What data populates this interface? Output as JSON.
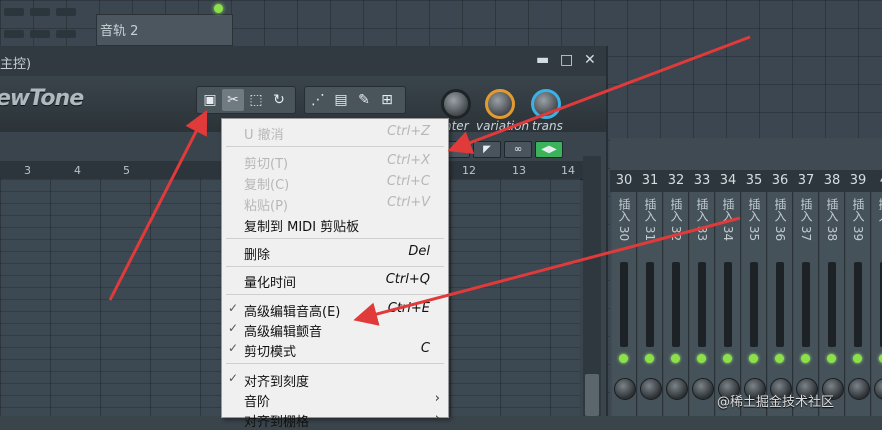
{
  "playlist": {
    "track_label": "音轨 2"
  },
  "window": {
    "title": "主控)",
    "minimize": "▬",
    "maximize": "□",
    "close": "✕",
    "logo": "ewTone",
    "knobs": [
      "nter",
      "variation",
      "trans"
    ],
    "ruler": [
      "3",
      "4",
      "5",
      "12",
      "13",
      "14"
    ]
  },
  "mixer": {
    "numbers": [
      "30",
      "31",
      "32",
      "33",
      "34",
      "35",
      "36",
      "37",
      "38",
      "39",
      "4"
    ],
    "labels": [
      "插入 30",
      "插入 31",
      "插入 32",
      "插入 33",
      "插入 34",
      "插入 35",
      "插入 36",
      "插入 37",
      "插入 38",
      "插入 39",
      "插入"
    ]
  },
  "menu": {
    "items": [
      {
        "label": "U 撤消",
        "shortcut": "Ctrl+Z"
      },
      {
        "label": "剪切(T)",
        "shortcut": "Ctrl+X"
      },
      {
        "label": "复制(C)",
        "shortcut": "Ctrl+C"
      },
      {
        "label": "粘贴(P)",
        "shortcut": "Ctrl+V"
      },
      {
        "label": "复制到 MIDI 剪贴板",
        "shortcut": ""
      },
      {
        "label": "删除",
        "shortcut": "Del"
      },
      {
        "label": "量化时间",
        "shortcut": "Ctrl+Q"
      },
      {
        "label": "高级编辑音高(E)",
        "shortcut": "Ctrl+E"
      },
      {
        "label": "高级编辑颤音",
        "shortcut": ""
      },
      {
        "label": "剪切模式",
        "shortcut": "C"
      },
      {
        "label": "对齐到刻度",
        "shortcut": ""
      },
      {
        "label": "音阶",
        "shortcut": ""
      },
      {
        "label": "对齐到棚格",
        "shortcut": ""
      }
    ]
  },
  "watermark": "@稀土掘金技术社区",
  "colors": {
    "accent_green": "#8ee04a",
    "arrow_red": "#e03a3a",
    "knob_orange": "#e39b2f",
    "knob_blue": "#3bb2e6"
  }
}
